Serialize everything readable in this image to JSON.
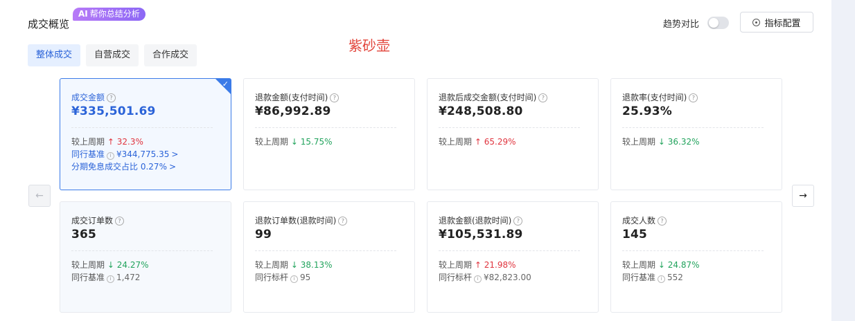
{
  "header": {
    "title": "成交概览",
    "ai_badge_prefix": "AI",
    "ai_badge_text": "帮你总结分析",
    "watermark": "紫砂壶",
    "trend_label": "趋势对比",
    "config_button": "指标配置"
  },
  "tabs": [
    {
      "label": "整体成交",
      "active": true
    },
    {
      "label": "自营成交",
      "active": false
    },
    {
      "label": "合作成交",
      "active": false
    }
  ],
  "nav": {
    "prev": "←",
    "next": "→"
  },
  "common": {
    "compare_label": "较上周期",
    "check": "✓",
    "qmark": "?",
    "info": "i",
    "chevron": ">"
  },
  "cards": [
    {
      "label": "成交金额",
      "value": "¥335,501.69",
      "compare": {
        "dir": "up",
        "arrow": "↑",
        "value": "32.3%"
      },
      "bench_label": "同行基准",
      "bench_value": "¥344,775.35",
      "extra_label": "分期免息成交占比",
      "extra_value": "0.27%"
    },
    {
      "label": "退款金额(支付时间)",
      "value": "¥86,992.89",
      "compare": {
        "dir": "down",
        "arrow": "↓",
        "value": "15.75%"
      }
    },
    {
      "label": "退款后成交金额(支付时间)",
      "value": "¥248,508.80",
      "compare": {
        "dir": "up",
        "arrow": "↑",
        "value": "65.29%"
      }
    },
    {
      "label": "退款率(支付时间)",
      "value": "25.93%",
      "compare": {
        "dir": "down",
        "arrow": "↓",
        "value": "36.32%"
      }
    },
    {
      "label": "成交订单数",
      "value": "365",
      "compare": {
        "dir": "down",
        "arrow": "↓",
        "value": "24.27%"
      },
      "bench_label": "同行基准",
      "bench_value": "1,472"
    },
    {
      "label": "退款订单数(退款时间)",
      "value": "99",
      "compare": {
        "dir": "down",
        "arrow": "↓",
        "value": "38.13%"
      },
      "bench_label": "同行标杆",
      "bench_value": "95"
    },
    {
      "label": "退款金额(退款时间)",
      "value": "¥105,531.89",
      "compare": {
        "dir": "up",
        "arrow": "↑",
        "value": "21.98%"
      },
      "bench_label": "同行标杆",
      "bench_value": "¥82,823.00"
    },
    {
      "label": "成交人数",
      "value": "145",
      "compare": {
        "dir": "down",
        "arrow": "↓",
        "value": "24.87%"
      },
      "bench_label": "同行基准",
      "bench_value": "552"
    }
  ],
  "colors": {
    "accent": "#3b7be8",
    "up": "#e0343e",
    "down": "#21a35c",
    "watermark": "#e2443a"
  }
}
